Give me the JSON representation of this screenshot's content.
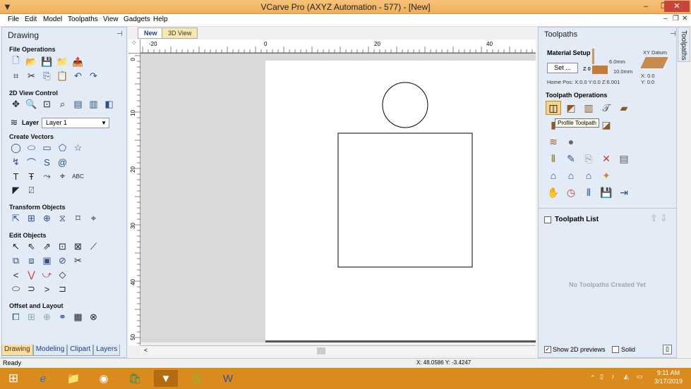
{
  "window": {
    "title": "VCarve Pro (AXYZ Automation - 577) - [New]",
    "minimize": "–",
    "restore": "❐",
    "close": "✕"
  },
  "menu": [
    "File",
    "Edit",
    "Model",
    "Toolpaths",
    "View",
    "Gadgets",
    "Help"
  ],
  "mdi": {
    "minimize": "–",
    "restore": "❐",
    "close": "✕"
  },
  "left_panel": {
    "title": "Drawing",
    "pin": "⊣",
    "sections": {
      "file_ops": "File Operations",
      "view_control": "2D View Control",
      "create_vectors": "Create Vectors",
      "transform": "Transform Objects",
      "edit": "Edit Objects",
      "offset": "Offset and Layout"
    },
    "layer_label": "Layer",
    "layer_value": "Layer 1",
    "tabs": [
      "Drawing",
      "Modeling",
      "Clipart",
      "Layers"
    ]
  },
  "view_tabs": {
    "new": "New",
    "view3d": "3D View"
  },
  "rulers": {
    "h_labels": [
      "-20",
      "0",
      "20",
      "40"
    ],
    "v_labels": [
      "0",
      "10",
      "20",
      "30",
      "40",
      "50"
    ]
  },
  "right_panel": {
    "title": "Toolpaths",
    "side_tab": "Toolpaths",
    "material_setup": "Material Setup",
    "thickness": "6.0mm",
    "z_label": "Z 0",
    "z_offset": "10.0mm",
    "set_button": "Set ...",
    "home_pos": "Home Pos:  X:0.0 Y:0.0 Z:6.001",
    "xy_datum": "XY Datum",
    "datum_x": "X: 0.0",
    "datum_y": "Y: 0.0",
    "operations_title": "Toolpath Operations",
    "tooltip": "Profile Toolpath",
    "list_title": "Toolpath List",
    "empty_text": "No Toolpaths Created Yet",
    "show_2d": "Show 2D previews",
    "solid": "Solid"
  },
  "status": {
    "left": "Ready",
    "coords": "X: 48.0586 Y: -3.4247"
  },
  "taskbar": {
    "time": "9:11 AM",
    "date": "3/17/2019"
  }
}
